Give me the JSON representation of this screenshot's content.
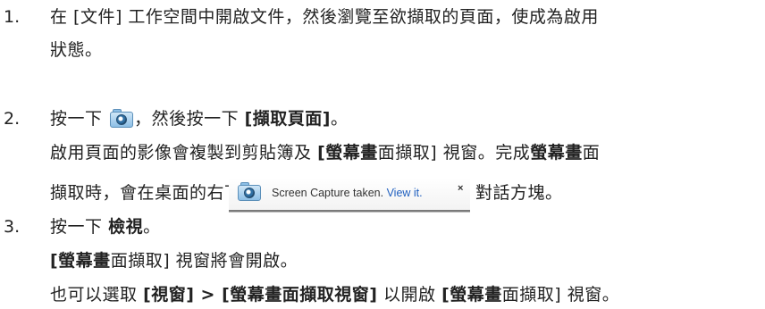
{
  "steps": [
    {
      "number": "1.",
      "line1": "在 [文件] 工作空間中開啟文件，然後瀏覽至欲擷取的頁面，使成為啟用",
      "line2": "狀態。"
    },
    {
      "number": "2.",
      "pre": "按一下",
      "mid": "，然後按一下",
      "bold": "[擷取頁面]",
      "end": "。",
      "para_a1": "啟用頁面的影像會複製到剪貼簿及",
      "para_a2": "[螢幕畫",
      "para_a3": "面擷取] 視窗。完成",
      "para_a4": "螢幕畫",
      "para_a5": "面",
      "para_b1": "擷取時，會在桌面的右下角開啟",
      "para_b2": "對話方塊。"
    },
    {
      "number": "3.",
      "pre": "按一下",
      "bold": "檢視",
      "end": "。",
      "p1a": "[螢幕畫",
      "p1b": "面擷取] 視窗將會開啟。",
      "p2a": "也可以選取",
      "p2b": "[視窗] > [螢幕畫面擷取視窗]",
      "p2c": "以開啟",
      "p2d": "[螢幕畫",
      "p2e": "面擷取] 視窗。"
    }
  ],
  "toast": {
    "message": "Screen Capture taken.",
    "link": "View it.",
    "close_symbol": "×",
    "icon": "camera-icon",
    "link_color": "#1f5fbf"
  }
}
